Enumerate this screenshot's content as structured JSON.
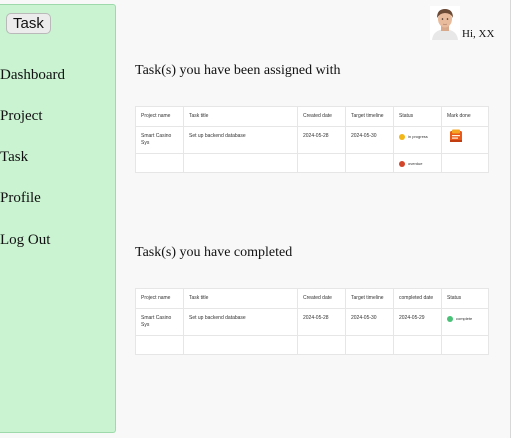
{
  "sidebar": {
    "brand_label": "Task",
    "items": [
      {
        "label": "Dashboard"
      },
      {
        "label": "Project"
      },
      {
        "label": "Task"
      },
      {
        "label": "Profile"
      },
      {
        "label": "Log Out"
      }
    ]
  },
  "user": {
    "greeting": "Hi, XX",
    "avatar_icon": "user-photo"
  },
  "assigned": {
    "title": "Task(s) you have been assigned with",
    "headers": [
      "Project name",
      "Task title",
      "Created date",
      "Target timeline",
      "Status",
      "Mark done"
    ],
    "rows": [
      {
        "project": "Smart Casino Sys",
        "task": "Set up backend database",
        "created": "2024-05-28",
        "target": "2024-05-30",
        "status": "in progress",
        "status_color": "#f2b619",
        "mark_icon": "mark-done-icon"
      },
      {
        "project": "",
        "task": "",
        "created": "",
        "target": "",
        "status": "overdue",
        "status_color": "#d2452b",
        "mark_icon": ""
      }
    ]
  },
  "completed": {
    "title": "Task(s) you have completed",
    "headers": [
      "Project name",
      "Task title",
      "Created date",
      "Target timeline",
      "completed date",
      "Status"
    ],
    "rows": [
      {
        "project": "Smart Casino Sys",
        "task": "Set up backend database",
        "created": "2024-05-28",
        "target": "2024-05-30",
        "completed": "2024-05-29",
        "status": "complete",
        "status_color": "#49c277"
      },
      {
        "project": "",
        "task": "",
        "created": "",
        "target": "",
        "completed": "",
        "status": "",
        "status_color": ""
      }
    ]
  },
  "colors": {
    "sidebar_bg": "#c9f3d1",
    "sidebar_border": "#9ed9ab",
    "mark_done": "#e8591a"
  }
}
